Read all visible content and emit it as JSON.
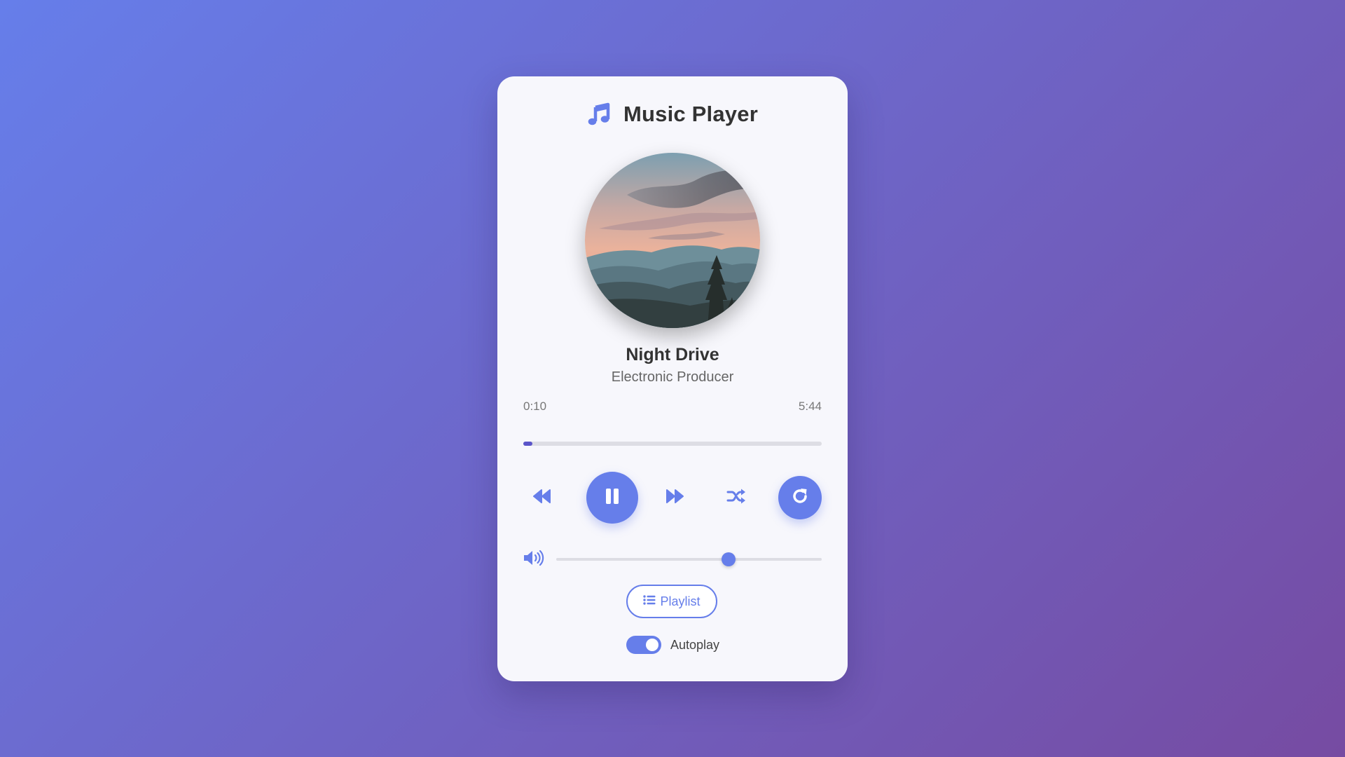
{
  "player": {
    "title": "Music Player",
    "title_icon": "music-note-icon",
    "album_art": "mountain-sunset-landscape",
    "song_title": "Night Drive",
    "artist": "Electronic Producer",
    "current_time": "0:10",
    "total_time": "5:44",
    "progress_fraction": 0.03,
    "controls": {
      "rewind_icon": "rewind-icon",
      "play_state": "playing",
      "pause_icon": "pause-icon",
      "forward_icon": "fast-forward-icon",
      "shuffle_icon": "shuffle-icon",
      "repeat_icon": "repeat-icon"
    },
    "volume": {
      "icon": "volume-high-icon",
      "level": 0.65
    },
    "playlist_button": {
      "icon": "list-icon",
      "label": "Playlist"
    },
    "autoplay": {
      "label": "Autoplay",
      "enabled": true
    }
  },
  "colors": {
    "accent": "#667eea",
    "progress_fill": "#5b55c9",
    "background_start": "#667eea",
    "background_end": "#764ba2",
    "card": "#f7f7fc",
    "text_primary": "#333333",
    "text_secondary": "#666666"
  }
}
